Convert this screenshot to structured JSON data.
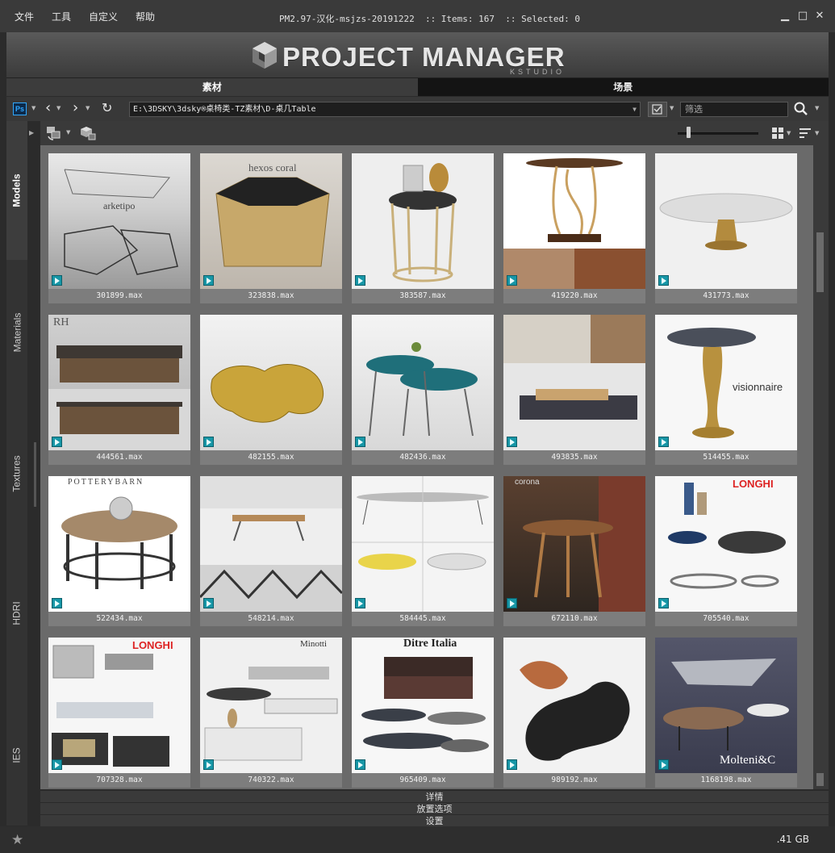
{
  "menu": [
    "文件",
    "工具",
    "自定义",
    "帮助"
  ],
  "window_title": "PM2.97-汉化-msjzs-20191222  :: Items: 167  :: Selected: 0",
  "window_controls": {
    "minimize": "minimize-icon",
    "maximize": "maximize-icon",
    "close": "close-icon"
  },
  "banner": {
    "title": "PROJECT MANAGER",
    "subtitle": "KSTUDIO"
  },
  "tabs": [
    {
      "label": "素材",
      "active": true
    },
    {
      "label": "场景",
      "active": false
    }
  ],
  "address": {
    "path": "E:\\3DSKY\\3dsky®桌椅类-TZ素材\\D-桌几Table",
    "filter_placeholder": "筛选"
  },
  "side_tabs": [
    "Models",
    "Materials",
    "Textures",
    "HDRI",
    "IES"
  ],
  "active_side_tab": "Models",
  "thumbnail_size_level": 0.15,
  "grid_items": [
    {
      "name": "301899.max",
      "label": "arketipo"
    },
    {
      "name": "323838.max",
      "label": "hexos coral"
    },
    {
      "name": "383587.max",
      "label": ""
    },
    {
      "name": "419220.max",
      "label": ""
    },
    {
      "name": "431773.max",
      "label": ""
    },
    {
      "name": "444561.max",
      "label": "RH"
    },
    {
      "name": "482155.max",
      "label": ""
    },
    {
      "name": "482436.max",
      "label": ""
    },
    {
      "name": "493835.max",
      "label": ""
    },
    {
      "name": "514455.max",
      "label": "visionnaire"
    },
    {
      "name": "522434.max",
      "label": "POTTERYBARN"
    },
    {
      "name": "548214.max",
      "label": ""
    },
    {
      "name": "584445.max",
      "label": ""
    },
    {
      "name": "672110.max",
      "label": "corona"
    },
    {
      "name": "705540.max",
      "label": "LONGHI"
    },
    {
      "name": "707328.max",
      "label": "LONGHI"
    },
    {
      "name": "740322.max",
      "label": "Minotti"
    },
    {
      "name": "965409.max",
      "label": "Ditre Italia"
    },
    {
      "name": "989192.max",
      "label": ""
    },
    {
      "name": "1168198.max",
      "label": "Molteni&C"
    }
  ],
  "bottom_panels": [
    "详情",
    "放置选项",
    "设置"
  ],
  "status": {
    "disk_size": ".41 GB"
  },
  "colors": {
    "max_badge": "#1796a6",
    "background": "#2b2b2b"
  }
}
